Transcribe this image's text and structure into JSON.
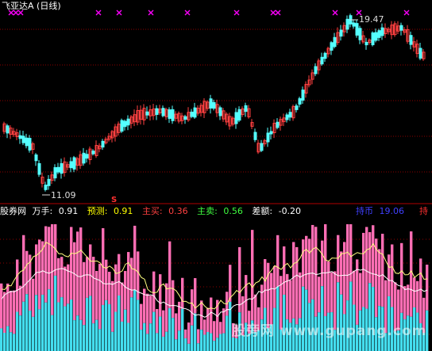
{
  "title": {
    "name": "飞亚达A",
    "period": "(日线)"
  },
  "price_labels": {
    "high": "19.47",
    "low": "11.09"
  },
  "signal_marker": "S",
  "indicator_bar": {
    "source": "股券网",
    "items": [
      {
        "label": "万手:",
        "value": "0.91"
      },
      {
        "label": "预测:",
        "value": "0.91"
      },
      {
        "label": "主买:",
        "value": "0.36"
      },
      {
        "label": "主卖:",
        "value": "0.56"
      },
      {
        "label": "差额:",
        "value": "-0.20"
      }
    ],
    "hold": {
      "label": "持币",
      "value": "19.06",
      "tag": "持"
    }
  },
  "watermark": "股旁网 www.gupang.com",
  "colors": {
    "background": "#000000",
    "up": "#ff4040",
    "down": "#54ffff",
    "gridline": "#8b0000",
    "signal": "#ff00ff",
    "bar_pink": "#ff6eb4",
    "bar_cyan": "#44ddee",
    "ma_yellow": "#ffff80",
    "ma_white": "#ffffff",
    "buy": "#ff4040",
    "sell": "#40ff40",
    "hold": "#4040ff",
    "text_white": "#ffffff",
    "text_yellow": "#ffff00"
  }
}
